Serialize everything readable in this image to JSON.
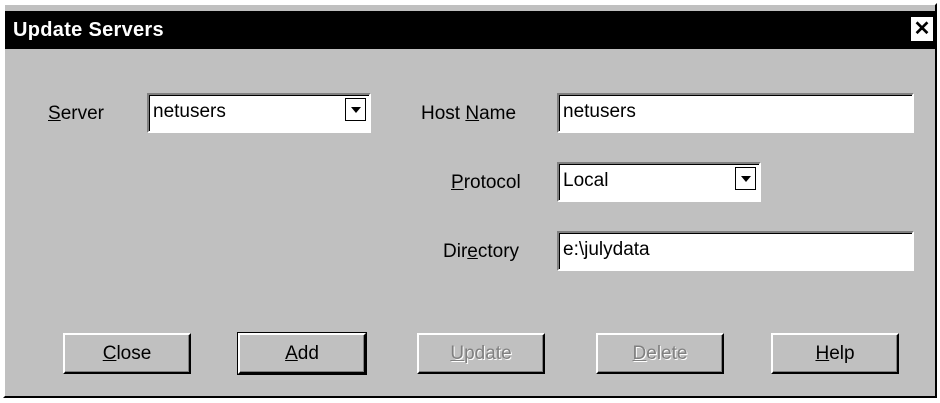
{
  "window": {
    "title": "Update Servers",
    "close_glyph": "✕"
  },
  "form": {
    "server": {
      "label_prefix": "",
      "label_ul": "S",
      "label_suffix": "erver",
      "value": "netusers"
    },
    "host_name": {
      "label_prefix": "Host ",
      "label_ul": "N",
      "label_suffix": "ame",
      "value": "netusers"
    },
    "protocol": {
      "label_prefix": "",
      "label_ul": "P",
      "label_suffix": "rotocol",
      "value": "Local"
    },
    "directory": {
      "label_prefix": "Dir",
      "label_ul": "e",
      "label_suffix": "ctory",
      "value": "e:\\julydata"
    }
  },
  "buttons": {
    "close": {
      "ul": "C",
      "rest": "lose",
      "enabled": true
    },
    "add": {
      "ul": "A",
      "rest": "dd",
      "enabled": true
    },
    "update": {
      "ul": "U",
      "rest": "pdate",
      "enabled": false
    },
    "delete": {
      "ul": "D",
      "rest": "elete",
      "enabled": false
    },
    "help": {
      "ul": "H",
      "rest": "elp",
      "enabled": true
    }
  },
  "icons": {
    "close": "close-icon",
    "dropdown": "chevron-down-icon"
  }
}
